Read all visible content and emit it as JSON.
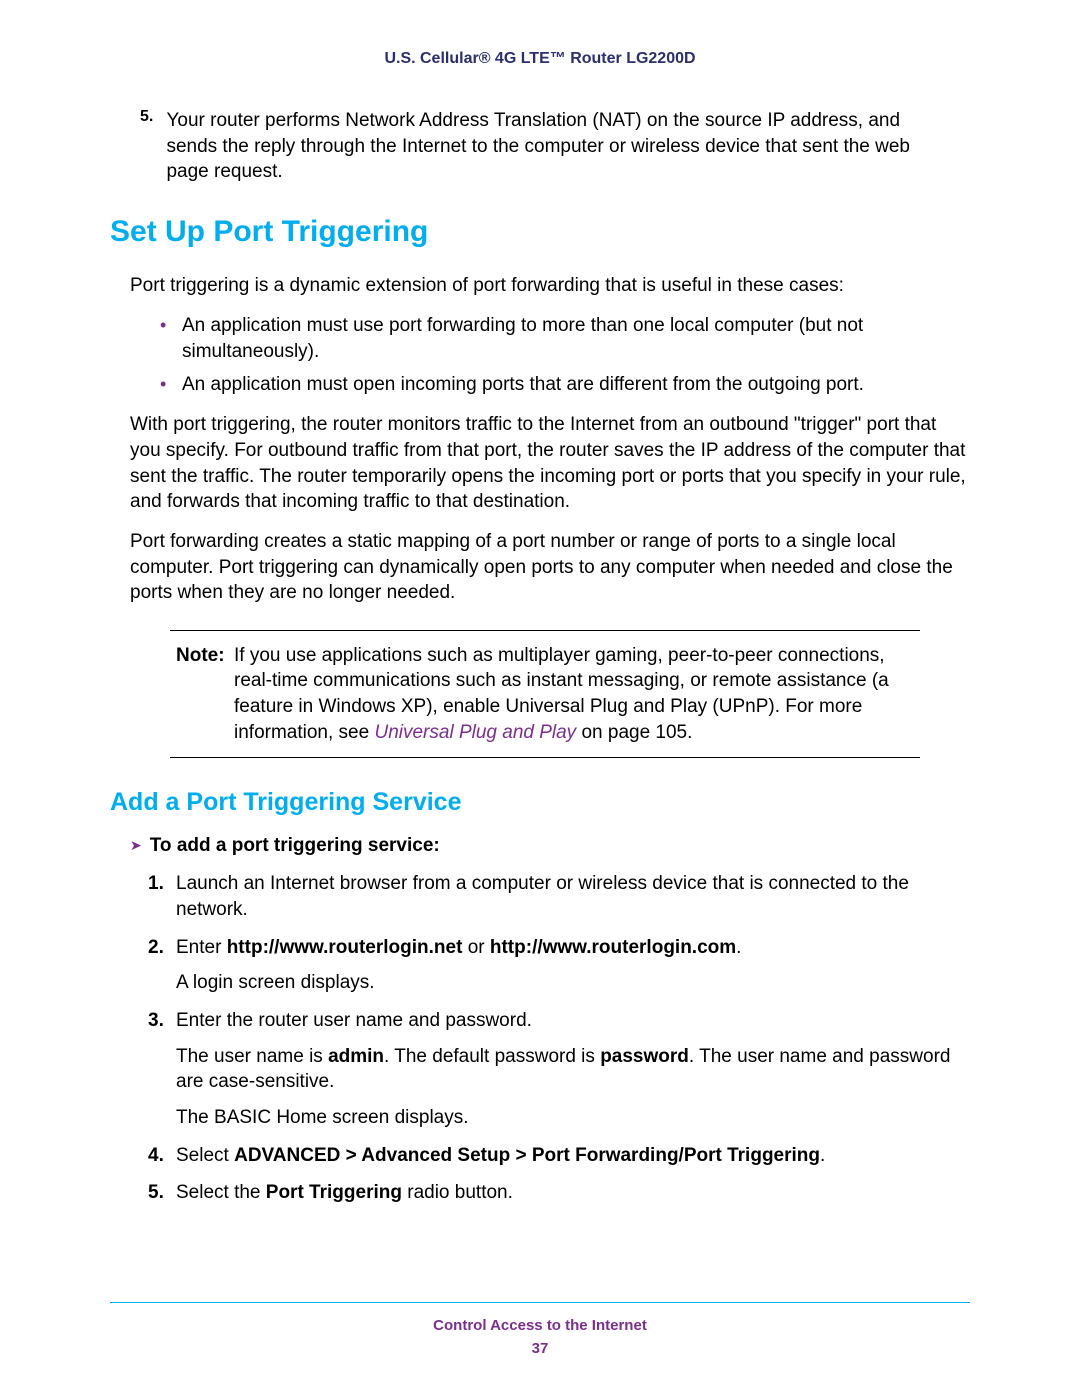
{
  "header": {
    "title": "U.S. Cellular® 4G LTE™ Router LG2200D"
  },
  "continued": {
    "num": "5.",
    "text": "Your router performs Network Address Translation (NAT) on the source IP address, and sends the reply through the Internet to the computer or wireless device that sent the web page request."
  },
  "h1": "Set Up Port Triggering",
  "intro": "Port triggering is a dynamic extension of port forwarding that is useful in these cases:",
  "bullets": [
    "An application must use port forwarding to more than one local computer (but not simultaneously).",
    "An application must open incoming ports that are different from the outgoing port."
  ],
  "para2": "With port triggering, the router monitors traffic to the Internet from an outbound \"trigger\" port that you specify. For outbound traffic from that port, the router saves the IP address of the computer that sent the traffic. The router temporarily opens the incoming port or ports that you specify in your rule, and forwards that incoming traffic to that destination.",
  "para3": "Port forwarding creates a static mapping of a port number or range of ports to a single local computer. Port triggering can dynamically open ports to any computer when needed and close the ports when they are no longer needed.",
  "note": {
    "label": "Note:",
    "before": "If you use applications such as multiplayer gaming, peer-to-peer connections, real-time communications such as instant messaging, or remote assistance (a feature in Windows XP), enable Universal Plug and Play (UPnP). For more information, see ",
    "link": "Universal Plug and Play",
    "after": "on page 105."
  },
  "h2": "Add a Port Triggering Service",
  "proc_title": "To add a port triggering service:",
  "steps": {
    "s1": {
      "n": "1.",
      "t": "Launch an Internet browser from a computer or wireless device that is connected to the network."
    },
    "s2": {
      "n": "2.",
      "pre": "Enter ",
      "b1": "http://www.routerlogin.net",
      "mid": " or ",
      "b2": "http://www.routerlogin.com",
      "post": ".",
      "sub": "A login screen displays."
    },
    "s3": {
      "n": "3.",
      "t": "Enter the router user name and password.",
      "sub1_pre": "The user name is ",
      "sub1_b1": "admin",
      "sub1_mid": ". The default password is ",
      "sub1_b2": "password",
      "sub1_post": ". The user name and password are case-sensitive.",
      "sub2": "The BASIC Home screen displays."
    },
    "s4": {
      "n": "4.",
      "pre": "Select ",
      "b": "ADVANCED > Advanced Setup > Port Forwarding/Port Triggering",
      "post": "."
    },
    "s5": {
      "n": "5.",
      "pre": "Select the ",
      "b": "Port Triggering",
      "post": " radio button."
    }
  },
  "footer": {
    "chapter": "Control Access to the Internet",
    "page": "37"
  }
}
